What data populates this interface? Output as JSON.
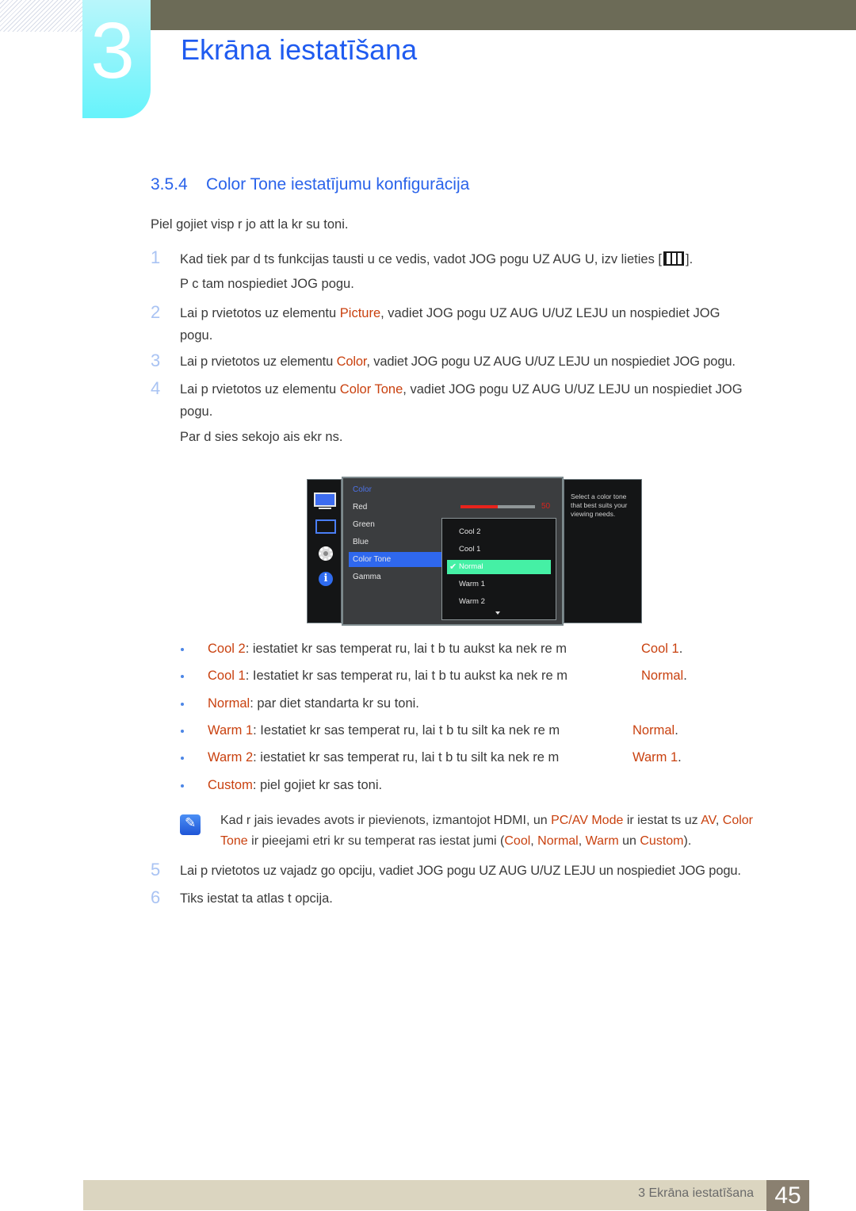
{
  "header": {
    "chapter_number": "3",
    "chapter_title": "Ekrāna iestatīšana"
  },
  "section": {
    "number": "3.5.4",
    "title": "Color Tone iestatījumu konfigurācija"
  },
  "intro": "Piel gojiet visp r jo att la kr su toni.",
  "steps": [
    {
      "num": "1",
      "line1": "Kad tiek par d ts funkcijas tausti u ce vedis, vadot JOG pogu UZ AUG U, izv lieties [",
      "line1_end": "].",
      "icon": "menu-icon",
      "line2": "P c tam nospiediet JOG pogu."
    },
    {
      "num": "2",
      "pre": "Lai p rvietotos uz elementu ",
      "hl": "Picture",
      "post": ", vadiet JOG pogu UZ AUG U/UZ LEJU un nospiediet JOG",
      "line2": "pogu."
    },
    {
      "num": "3",
      "pre": "Lai p rvietotos uz elementu ",
      "hl": "Color",
      "post": ", vadiet JOG pogu UZ AUG U/UZ LEJU un nospiediet JOG pogu."
    },
    {
      "num": "4",
      "pre": "Lai p rvietotos uz elementu ",
      "hl": "Color Tone",
      "post": ", vadiet JOG pogu UZ AUG U/UZ LEJU un nospiediet JOG",
      "line2": "pogu.",
      "line3": "Par d sies sekojo ais ekr ns."
    },
    {
      "num": "5",
      "text": "Lai p rvietotos uz vajadz go opciju, vadiet JOG pogu UZ AUG U/UZ LEJU un nospiediet JOG pogu."
    },
    {
      "num": "6",
      "text": "Tiks iestat ta atlas t opcija."
    }
  ],
  "osd": {
    "sidebar_icons": [
      "picture-icon",
      "position-icon",
      "settings-icon",
      "info-icon"
    ],
    "category": "Color",
    "items": [
      "Red",
      "Green",
      "Blue",
      "Color Tone",
      "Gamma"
    ],
    "selected_item": "Color Tone",
    "red_value": "50",
    "red_fraction": 0.5,
    "options": [
      "Cool 2",
      "Cool 1",
      "Normal",
      "Warm 1",
      "Warm 2"
    ],
    "selected_option": "Normal",
    "help_text": "Select a color tone that best suits your viewing needs.",
    "accent_color": "#45f0a5",
    "select_color": "#2f68ee"
  },
  "bullets": [
    {
      "name": "Cool 2",
      "text": ": iestatiet kr sas temperat ru, lai t  b tu aukst ka nek  re  m",
      "ref": "Cool 1",
      "end": "."
    },
    {
      "name": "Cool 1",
      "text": ": Iestatiet kr sas temperat ru, lai t  b tu aukst ka nek  re  m",
      "ref": "Normal",
      "end": "."
    },
    {
      "name": "Normal",
      "text": ": par diet standarta kr su toni."
    },
    {
      "name": "Warm 1",
      "text": ": Iestatiet kr sas temperat ru, lai t  b tu silt ka nek  re  m",
      "ref": "Normal",
      "end": "."
    },
    {
      "name": "Warm 2",
      "text": ": iestatiet kr sas temperat ru, lai t  b tu silt ka nek  re  m",
      "ref": "Warm 1",
      "end": "."
    },
    {
      "name": "Custom",
      "text": ": piel gojiet kr sas toni."
    }
  ],
  "note": {
    "t1": "Kad  r jais ievades avots ir pievienots, izmantojot HDMI, un ",
    "h1": "PC/AV Mode",
    "t2": " ir iestat ts uz ",
    "h2": "AV",
    "t3": ", ",
    "h3": "Color",
    "h4": "Tone",
    "t4": " ir pieejami  etri kr su temperat ras iestat jumi (",
    "h5": "Cool",
    "t5": ", ",
    "h6": "Normal",
    "t6": ", ",
    "h7": "Warm",
    "t7": " un ",
    "h8": "Custom",
    "t8": ")."
  },
  "footer": {
    "chapter_label": "3 Ekrāna iestatīšana",
    "page_number": "45"
  },
  "colors": {
    "title_blue": "#1f5bf0",
    "highlight": "#c9410f",
    "header_bar": "#6c6b57",
    "footer_bar": "#dbd5c0",
    "page_box": "#8a8070"
  }
}
